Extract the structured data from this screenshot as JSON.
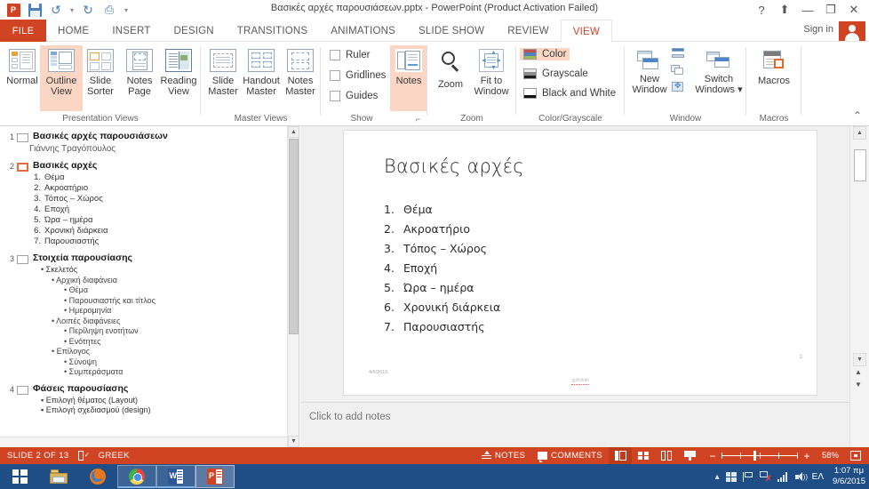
{
  "titlebar": {
    "app_icon": "powerpoint-icon",
    "document_title": "Βασικές αρχές παρουσιάσεων.pptx - PowerPoint (Product Activation Failed)",
    "qat": [
      {
        "name": "save",
        "glyph": "save-icon"
      },
      {
        "name": "undo",
        "glyph": "undo-icon"
      },
      {
        "name": "redo",
        "glyph": "redo-icon"
      },
      {
        "name": "start-from-beginning",
        "glyph": "slideshow-icon"
      },
      {
        "name": "customize-qat",
        "glyph": "chevron-down-icon"
      }
    ],
    "window_buttons": {
      "help": "?",
      "ribbon_display": "⬆",
      "minimize": "—",
      "restore": "❐",
      "close": "✕"
    }
  },
  "tabs": {
    "file": "FILE",
    "items": [
      "HOME",
      "INSERT",
      "DESIGN",
      "TRANSITIONS",
      "ANIMATIONS",
      "SLIDE SHOW",
      "REVIEW",
      "VIEW"
    ],
    "active": "VIEW",
    "sign_in": "Sign in"
  },
  "ribbon": {
    "groups": [
      {
        "name": "Presentation Views",
        "label": "Presentation Views",
        "buttons": [
          {
            "label_line1": "Normal",
            "label_line2": "",
            "selected": false
          },
          {
            "label_line1": "Outline",
            "label_line2": "View",
            "selected": true
          },
          {
            "label_line1": "Slide",
            "label_line2": "Sorter",
            "selected": false
          },
          {
            "label_line1": "Notes",
            "label_line2": "Page",
            "selected": false
          },
          {
            "label_line1": "Reading",
            "label_line2": "View",
            "selected": false
          }
        ]
      },
      {
        "name": "Master Views",
        "label": "Master Views",
        "buttons": [
          {
            "label_line1": "Slide",
            "label_line2": "Master",
            "selected": false
          },
          {
            "label_line1": "Handout",
            "label_line2": "Master",
            "selected": false
          },
          {
            "label_line1": "Notes",
            "label_line2": "Master",
            "selected": false
          }
        ]
      },
      {
        "name": "Show",
        "label": "Show",
        "checkboxes": [
          {
            "label": "Ruler",
            "checked": false
          },
          {
            "label": "Gridlines",
            "checked": false
          },
          {
            "label": "Guides",
            "checked": false
          }
        ],
        "notes_button": "Notes",
        "dialog_launcher": "⌐"
      },
      {
        "name": "Zoom",
        "label": "Zoom",
        "buttons": [
          {
            "label_line1": "Zoom",
            "label_line2": ""
          },
          {
            "label_line1": "Fit to",
            "label_line2": "Window"
          }
        ]
      },
      {
        "name": "Color/Grayscale",
        "label": "Color/Grayscale",
        "items": [
          {
            "label": "Color",
            "selected": true
          },
          {
            "label": "Grayscale",
            "selected": false
          },
          {
            "label": "Black and White",
            "selected": false
          }
        ]
      },
      {
        "name": "Window",
        "label": "Window",
        "buttons": [
          {
            "label_line1": "New",
            "label_line2": "Window"
          },
          {
            "label_line1": "Switch",
            "label_line2": "Windows ▾"
          }
        ],
        "small_buttons": [
          "arrange-all",
          "cascade",
          "move-split"
        ]
      },
      {
        "name": "Macros",
        "label": "Macros",
        "buttons": [
          {
            "label_line1": "Macros",
            "label_line2": ""
          }
        ]
      }
    ],
    "collapse": "⌃"
  },
  "outline": {
    "slides": [
      {
        "number": "1",
        "title": "Βασικές αρχές παρουσιάσεων",
        "active": false,
        "lines": [
          {
            "level": "sub",
            "text": "Γιάννης Τραγόπουλος"
          }
        ]
      },
      {
        "number": "2",
        "title": "Βασικές αρχές",
        "active": true,
        "lines": [
          {
            "level": "n1",
            "num": "1.",
            "text": "Θέμα"
          },
          {
            "level": "n1",
            "num": "2.",
            "text": "Ακροατήριο"
          },
          {
            "level": "n1",
            "num": "3.",
            "text": "Τόπος – Χώρος"
          },
          {
            "level": "n1",
            "num": "4.",
            "text": "Εποχή"
          },
          {
            "level": "n1",
            "num": "5.",
            "text": "Ώρα – ημέρα"
          },
          {
            "level": "n1",
            "num": "6.",
            "text": "Χρονική διάρκεια"
          },
          {
            "level": "n1",
            "num": "7.",
            "text": "Παρουσιαστής"
          }
        ]
      },
      {
        "number": "3",
        "title": "Στοιχεία παρουσίασης",
        "active": false,
        "lines": [
          {
            "level": "b1",
            "text": "• Σκελετός"
          },
          {
            "level": "b2",
            "text": "• Αρχική διαφάνεια"
          },
          {
            "level": "b3",
            "text": "• Θέμα"
          },
          {
            "level": "b3",
            "text": "• Παρουσιαστής και τίτλος"
          },
          {
            "level": "b3",
            "text": "• Ημερομηνία"
          },
          {
            "level": "b2",
            "text": "• Λοιπές διαφάνειες"
          },
          {
            "level": "b3",
            "text": "• Περίληψη ενοτήτων"
          },
          {
            "level": "b3",
            "text": "• Ενότητες"
          },
          {
            "level": "b2",
            "text": "• Επίλογος"
          },
          {
            "level": "b3",
            "text": "• Σύνοψη"
          },
          {
            "level": "b3",
            "text": "• Συμπεράσματα"
          }
        ]
      },
      {
        "number": "4",
        "title": "Φάσεις παρουσίασης",
        "active": false,
        "lines": [
          {
            "level": "b1",
            "text": "▪ Επιλογή θέματος (Layout)"
          },
          {
            "level": "b1",
            "text": "▪ Επιλογή σχεδιασμού (design)"
          }
        ]
      }
    ]
  },
  "slide": {
    "title": "Βασικές αρχές",
    "items": [
      {
        "num": "1.",
        "text": "Θέμα"
      },
      {
        "num": "2.",
        "text": "Ακροατήριο"
      },
      {
        "num": "3.",
        "text": "Τόπος – Χώρος"
      },
      {
        "num": "4.",
        "text": "Εποχή"
      },
      {
        "num": "5.",
        "text": "Ώρα – ημέρα"
      },
      {
        "num": "6.",
        "text": "Χρονική διάρκεια"
      },
      {
        "num": "7.",
        "text": "Παρουσιαστής"
      }
    ],
    "date": "4/6/2015",
    "footer": "gjdhlkjkl",
    "page_number": "2"
  },
  "notes": {
    "placeholder": "Click to add notes"
  },
  "statusbar": {
    "slide_counter": "SLIDE 2 OF 13",
    "language": "GREEK",
    "notes_label": "NOTES",
    "comments_label": "COMMENTS",
    "zoom_percent": "58%",
    "view_buttons": [
      "normal-view",
      "slide-sorter-view",
      "reading-view",
      "slide-show-view"
    ],
    "zoom_out": "−",
    "zoom_in": "+"
  },
  "taskbar": {
    "items": [
      {
        "name": "start-button",
        "icon": "windows-logo-icon"
      },
      {
        "name": "file-explorer",
        "icon": "folder-icon"
      },
      {
        "name": "firefox",
        "icon": "firefox-icon"
      },
      {
        "name": "chrome",
        "icon": "chrome-icon"
      },
      {
        "name": "word",
        "icon": "word-icon"
      },
      {
        "name": "powerpoint",
        "icon": "powerpoint-icon"
      }
    ],
    "tray": {
      "language": "ΕΛ",
      "time": "1:07 πμ",
      "date": "9/6/2015"
    }
  },
  "colors": {
    "accent": "#d04423",
    "selection": "#fbd6c4",
    "taskbar": "#1f4e87"
  }
}
